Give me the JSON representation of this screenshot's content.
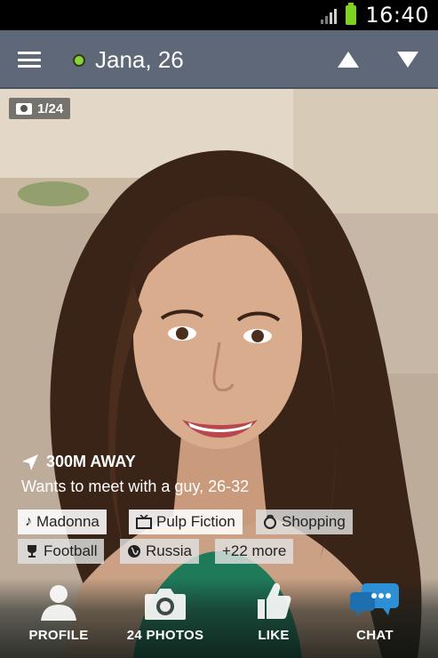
{
  "status_bar": {
    "time": "16:40"
  },
  "header": {
    "name": "Jana, 26",
    "online_color": "#8bd13a"
  },
  "photo": {
    "counter": "1/24"
  },
  "info": {
    "distance": "300M AWAY",
    "wants": "Wants to meet with a guy, 26-32"
  },
  "tags": [
    {
      "label": "Madonna",
      "icon": "music-note-icon"
    },
    {
      "label": "Pulp Fiction",
      "icon": "tv-icon"
    },
    {
      "label": "Shopping",
      "icon": "shopping-icon"
    },
    {
      "label": "Football",
      "icon": "trophy-icon"
    },
    {
      "label": "Russia",
      "icon": "globe-icon"
    },
    {
      "label": "+22 more",
      "icon": ""
    }
  ],
  "bottom_nav": [
    {
      "label": "PROFILE",
      "icon": "profile-icon"
    },
    {
      "label": "24 PHOTOS",
      "icon": "camera-icon"
    },
    {
      "label": "LIKE",
      "icon": "thumbs-up-icon"
    },
    {
      "label": "CHAT",
      "icon": "chat-icon"
    }
  ],
  "colors": {
    "appbar": "#5e6878",
    "chat_accent": "#2d8fd5",
    "battery": "#7ed321"
  }
}
